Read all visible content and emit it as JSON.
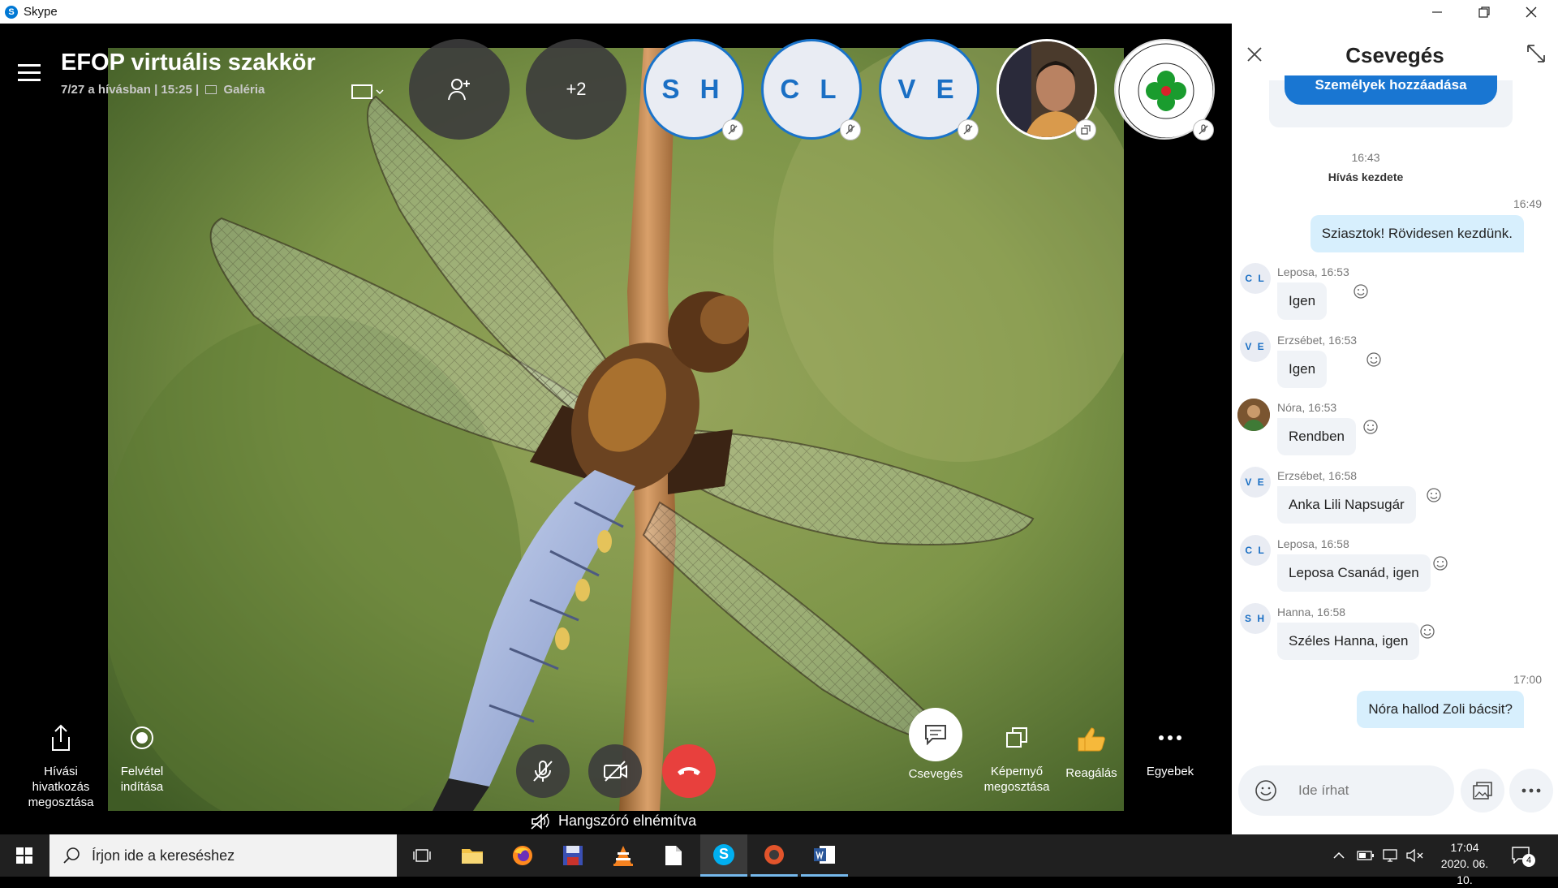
{
  "window": {
    "app_title": "Skype"
  },
  "call": {
    "title": "EFOP virtuális szakkör",
    "meta_prefix": "7/27 a hívásban | 15:25 |",
    "gallery_label": "Galéria",
    "extra_participants": "+2",
    "participants": [
      {
        "initials": "S H"
      },
      {
        "initials": "C L"
      },
      {
        "initials": "V E"
      }
    ],
    "speaker_status": "Hangszóró elnémítva"
  },
  "left_tools": {
    "share_link": "Hívási hivatkozás megosztása",
    "record": "Felvétel indítása"
  },
  "right_tools": {
    "chat": "Csevegés",
    "screen_share": "Képernyő megosztása",
    "react": "Reagálás",
    "more": "Egyebek"
  },
  "chat": {
    "title": "Csevegés",
    "add_people_button": "Személyek hozzáadása",
    "call_start_time": "16:43",
    "call_start_label": "Hívás kezdete",
    "messages": [
      {
        "time": "16:49",
        "text": "Sziasztok! Rövidesen kezdünk."
      },
      {
        "initials": "C L",
        "sender": "Leposa, 16:53",
        "text": "Igen"
      },
      {
        "initials": "V E",
        "sender": "Erzsébet, 16:53",
        "text": "Igen"
      },
      {
        "sender": "Nóra, 16:53",
        "text": "Rendben"
      },
      {
        "initials": "V E",
        "sender": "Erzsébet, 16:58",
        "text": "Anka Lili Napsugár"
      },
      {
        "initials": "C L",
        "sender": "Leposa, 16:58",
        "text": "Leposa Csanád, igen"
      },
      {
        "initials": "S H",
        "sender": "Hanna, 16:58",
        "text": "Széles Hanna, igen"
      },
      {
        "time": "17:00",
        "text": "Nóra hallod Zoli bácsit?"
      }
    ],
    "input_placeholder": "Ide írhat"
  },
  "taskbar": {
    "search_placeholder": "Írjon ide a kereséshez",
    "time": "17:04",
    "date": "2020. 06. 10.",
    "notification_count": "4"
  },
  "colors": {
    "accent": "#0078d4",
    "hangup": "#e8403d",
    "outgoing_bubble": "#d7effd"
  }
}
